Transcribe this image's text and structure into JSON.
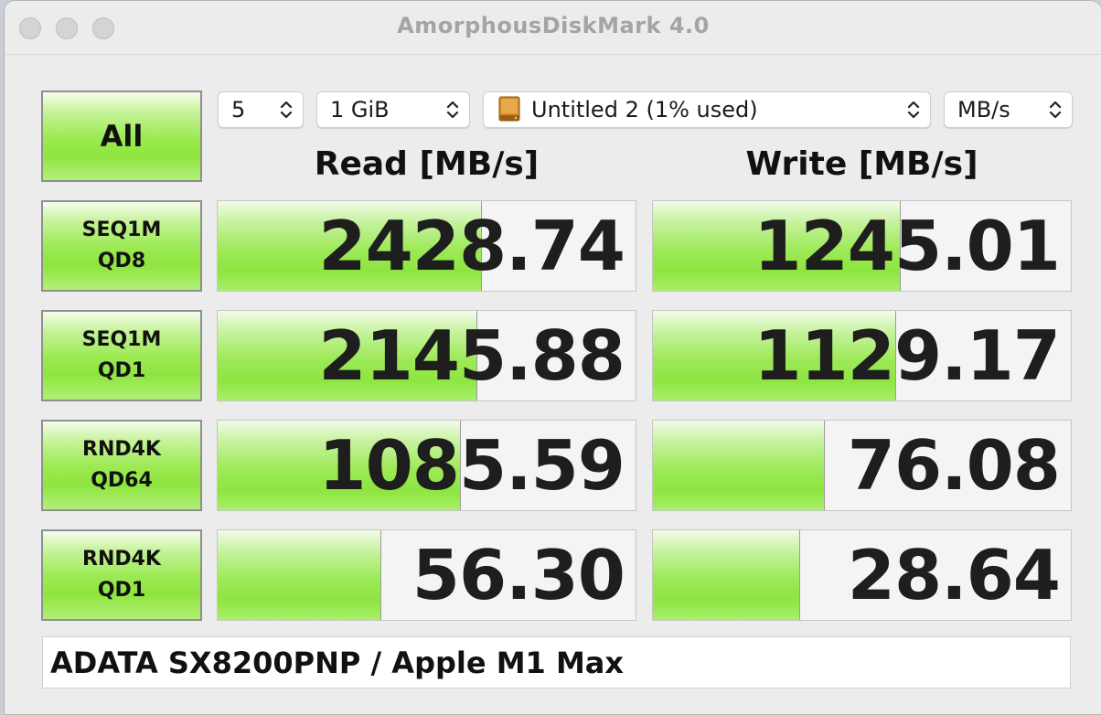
{
  "window": {
    "title": "AmorphousDiskMark 4.0"
  },
  "controls": {
    "all_label": "All",
    "count": "5",
    "size": "1 GiB",
    "disk": "Untitled 2 (1% used)",
    "unit": "MB/s"
  },
  "headers": {
    "read": "Read [MB/s]",
    "write": "Write [MB/s]"
  },
  "bar_max_mbps": 2800,
  "tests": [
    {
      "line1": "SEQ1M",
      "line2": "QD8",
      "read": "2428.74",
      "write": "1245.01",
      "read_fill": 0.63,
      "write_fill": 0.59
    },
    {
      "line1": "SEQ1M",
      "line2": "QD1",
      "read": "2145.88",
      "write": "1129.17",
      "read_fill": 0.62,
      "write_fill": 0.58
    },
    {
      "line1": "RND4K",
      "line2": "QD64",
      "read": "1085.59",
      "write": "76.08",
      "read_fill": 0.58,
      "write_fill": 0.41
    },
    {
      "line1": "RND4K",
      "line2": "QD1",
      "read": "56.30",
      "write": "28.64",
      "read_fill": 0.39,
      "write_fill": 0.35
    }
  ],
  "footer": {
    "device": "ADATA SX8200PNP / Apple M1 Max"
  },
  "colors": {
    "bar_green": "#8fe53e",
    "window_bg": "#ececec"
  },
  "icons": [
    "close-icon",
    "minimize-icon",
    "zoom-icon",
    "chevron-updown-icon",
    "external-disk-icon"
  ]
}
